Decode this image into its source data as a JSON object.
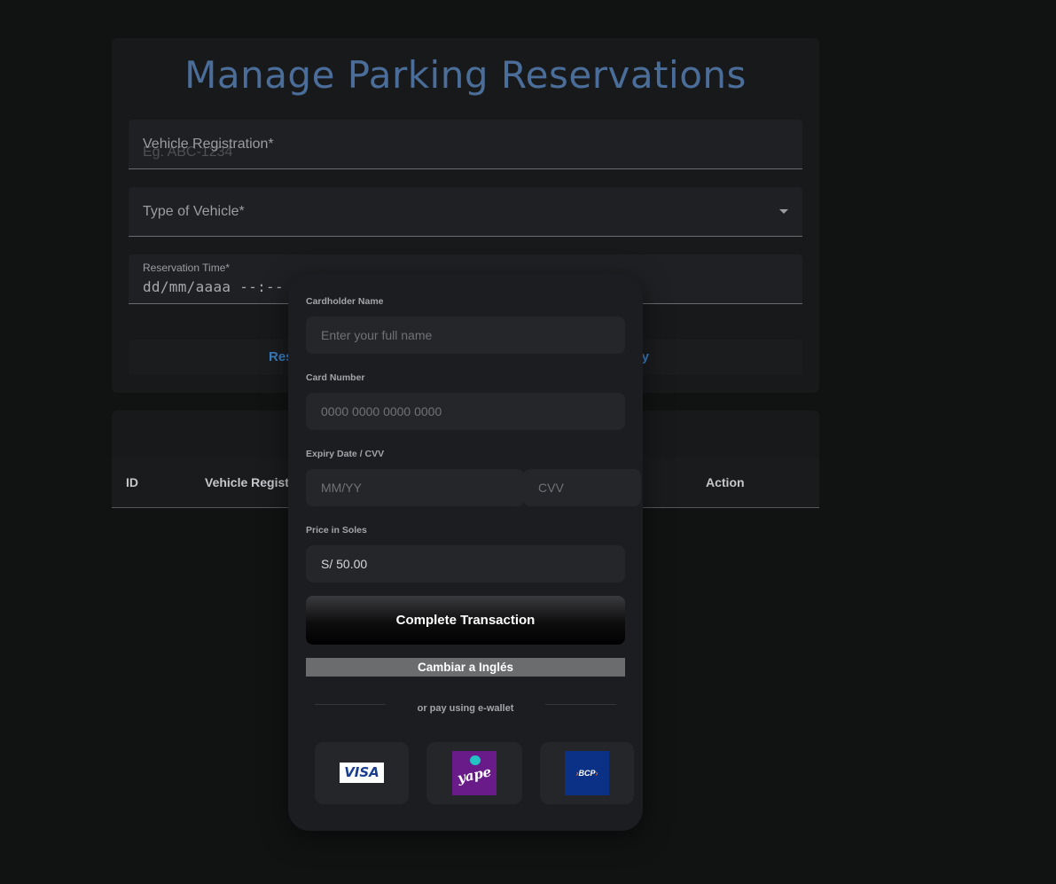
{
  "page": {
    "title": "Manage Parking Reservations"
  },
  "form": {
    "vehicle_registration_label": "Vehicle Registration*",
    "vehicle_registration_placeholder": "Eg. ABC-1234",
    "vehicle_type_label": "Type of Vehicle*",
    "reservation_time_label": "Reservation Time*",
    "reservation_time_value": "dd/mm/aaaa --:--",
    "left_button_label": "Res",
    "right_button_label": "y"
  },
  "table": {
    "headers": [
      "ID",
      "Vehicle Registr",
      "Action"
    ]
  },
  "payment": {
    "cardholder_label": "Cardholder Name",
    "cardholder_placeholder": "Enter your full name",
    "card_number_label": "Card Number",
    "card_number_placeholder": "0000 0000 0000 0000",
    "expiry_cvv_label": "Expiry Date / CVV",
    "expiry_placeholder": "MM/YY",
    "cvv_placeholder": "CVV",
    "price_label": "Price in Soles",
    "price_value": "S/ 50.00",
    "complete_button": "Complete Transaction",
    "language_button": "Cambiar a Inglés",
    "divider_text": "or pay using e-wallet",
    "wallets": [
      {
        "name": "VISA",
        "icon": "visa-logo"
      },
      {
        "name": "yape",
        "icon": "yape-logo"
      },
      {
        "name": "BCP",
        "icon": "bcp-logo"
      }
    ]
  },
  "colors": {
    "background": "#111313",
    "title": "#4b6d99",
    "link_blue": "#3a7fc4",
    "modal": "#1c1d20",
    "yape_purple": "#6a1b8a",
    "bcp_blue": "#0a3185"
  }
}
